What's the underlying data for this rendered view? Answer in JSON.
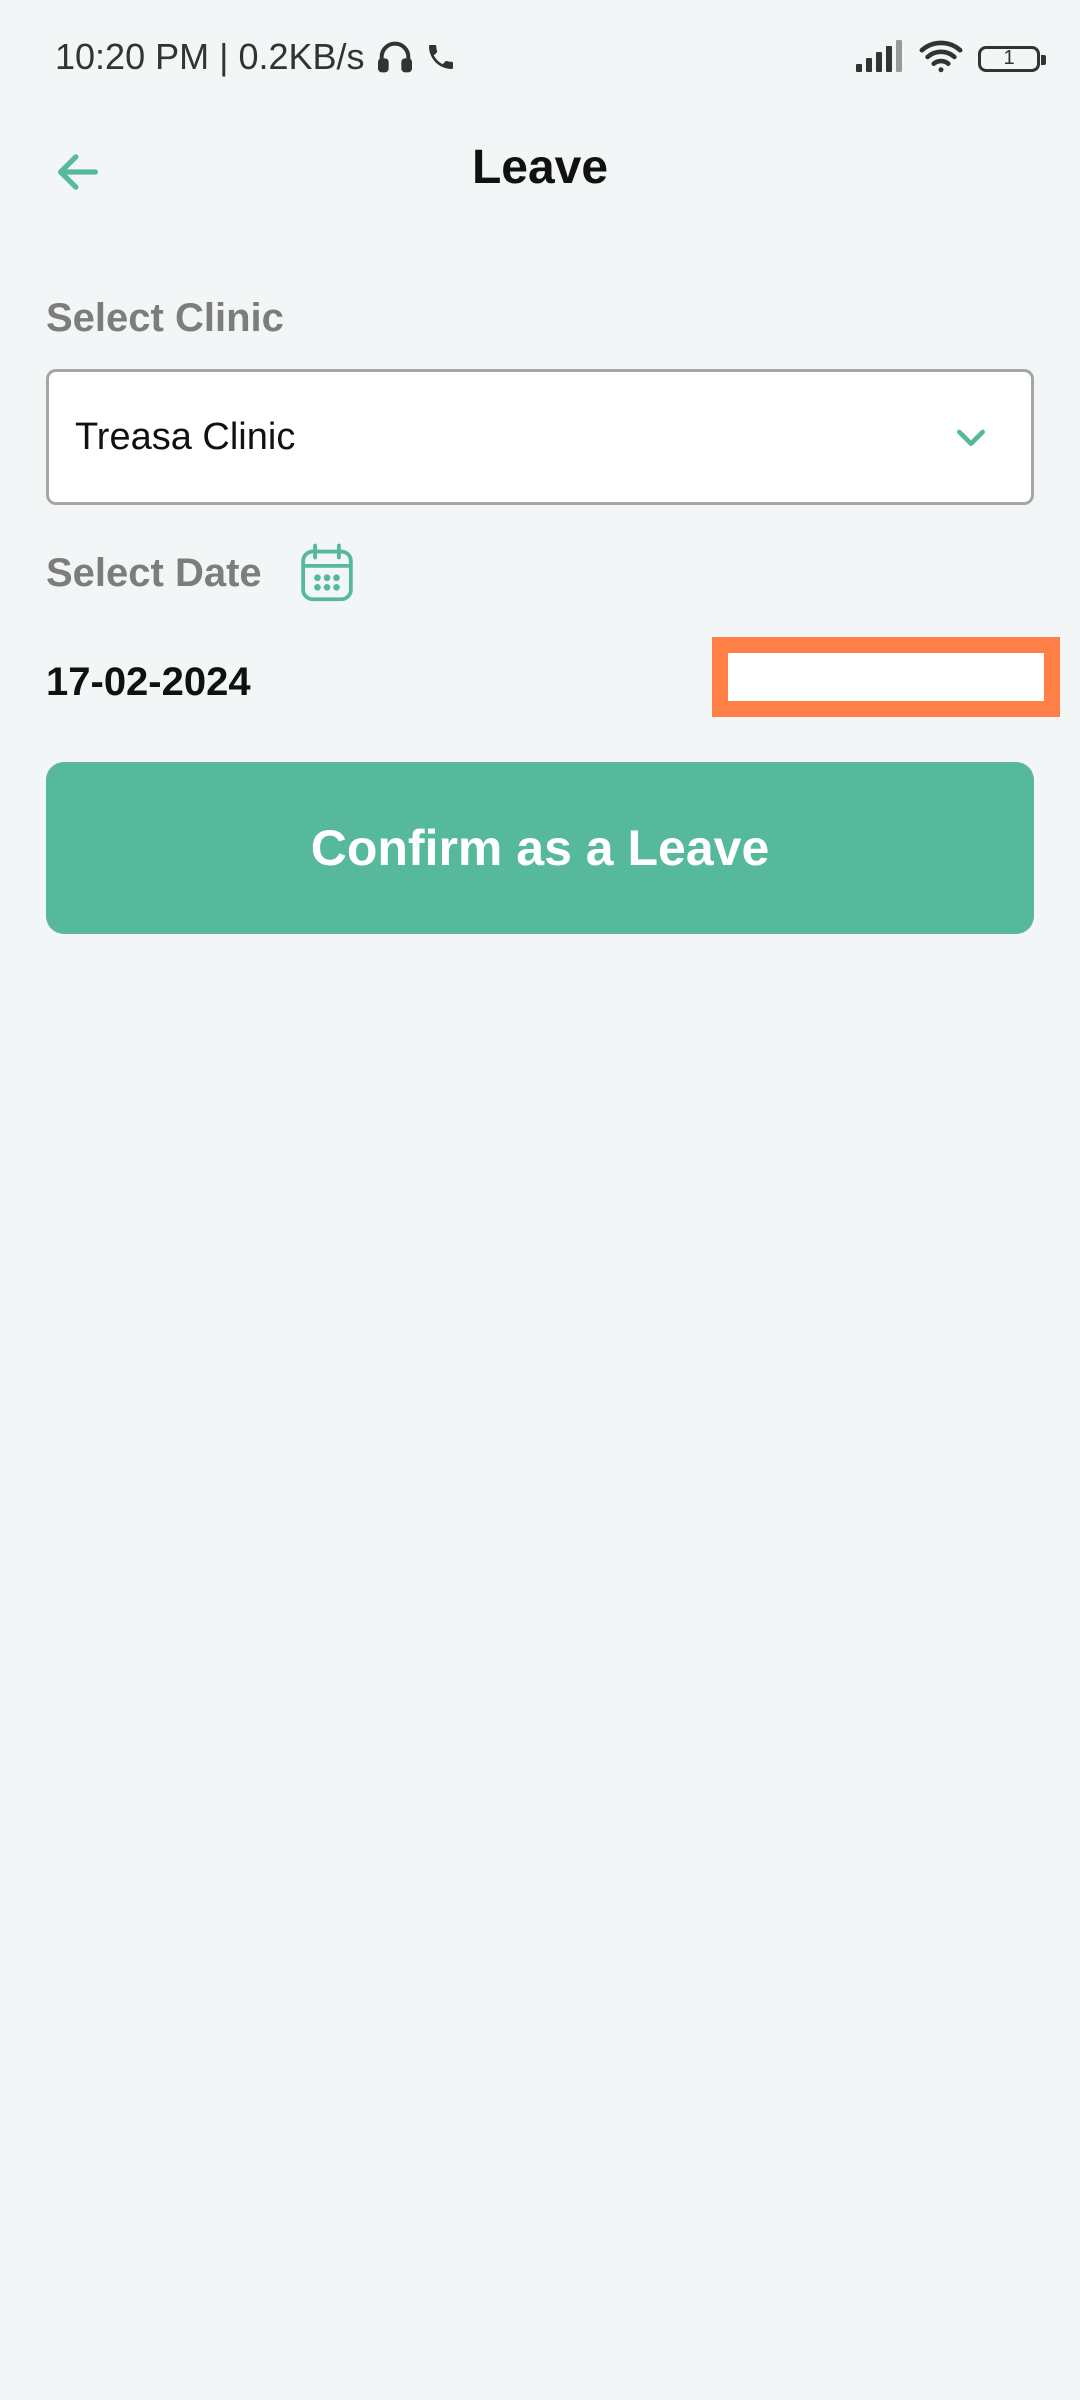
{
  "status_bar": {
    "time_speed": "10:20 PM | 0.2KB/s",
    "battery_level": "1",
    "icons": [
      "headset-icon",
      "phone-call-icon",
      "signal-icon",
      "wifi-icon",
      "battery-icon"
    ]
  },
  "app_bar": {
    "title": "Leave",
    "back_icon": "arrow-left-icon"
  },
  "form": {
    "clinic_label": "Select Clinic",
    "clinic_value": "Treasa Clinic",
    "dropdown_icon": "chevron-down-icon",
    "date_label": "Select Date",
    "calendar_icon": "calendar-icon",
    "date_value": "17-02-2024",
    "confirm_label": "Confirm as a Leave"
  },
  "colors": {
    "accent": "#56b99b",
    "highlight": "#ff7f47",
    "background": "#f2f6f7"
  }
}
